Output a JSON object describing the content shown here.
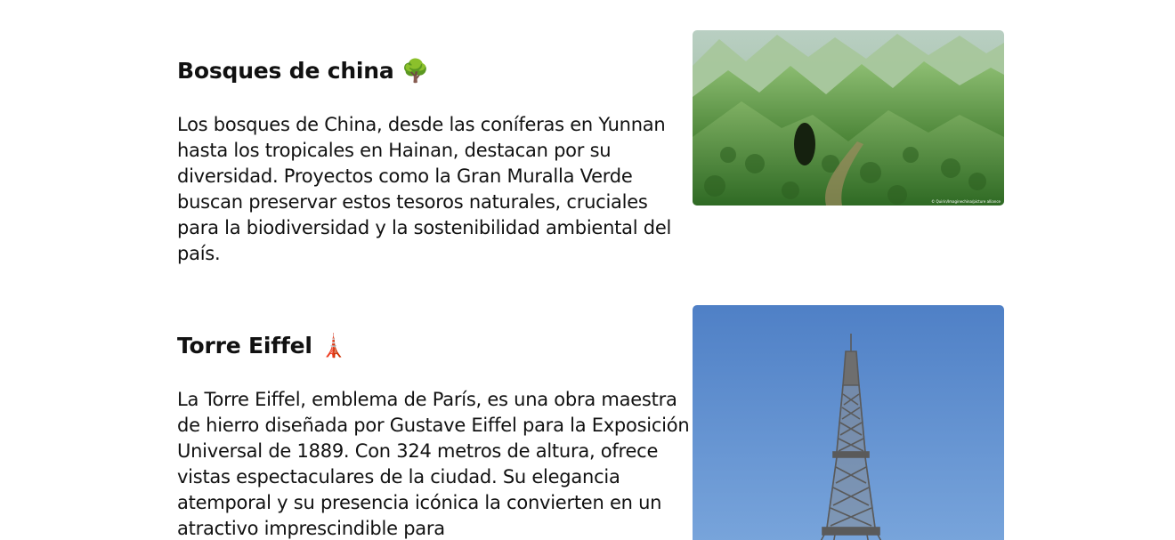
{
  "cards": [
    {
      "title": "Bosques de china 🌳",
      "description": "Los bosques de China, desde las coníferas en Yunnan hasta los tropicales en Hainan, destacan por su diversidad. Proyectos como la Gran Muralla Verde buscan preservar estos tesoros naturales, cruciales para la biodiversidad y la sostenibilidad ambiental del país.",
      "image": "forested-karst-mountains-with-sinkhole",
      "image_credit": "© Quirin/Imaginechina/picture alliance"
    },
    {
      "title": "Torre Eiffel 🗼",
      "description": "La Torre Eiffel, emblema de París, es una obra maestra de hierro diseñada por Gustave Eiffel para la Exposición Universal de 1889. Con 324 metros de altura, ofrece vistas espectaculares de la ciudad. Su elegancia atemporal y su presencia icónica la convierten en un atractivo imprescindible para",
      "image": "eiffel-tower-against-blue-sky"
    }
  ],
  "colors": {
    "text": "#111111",
    "background": "#ffffff",
    "sky": "#5b8fcf",
    "forest": "#4f8a34"
  }
}
